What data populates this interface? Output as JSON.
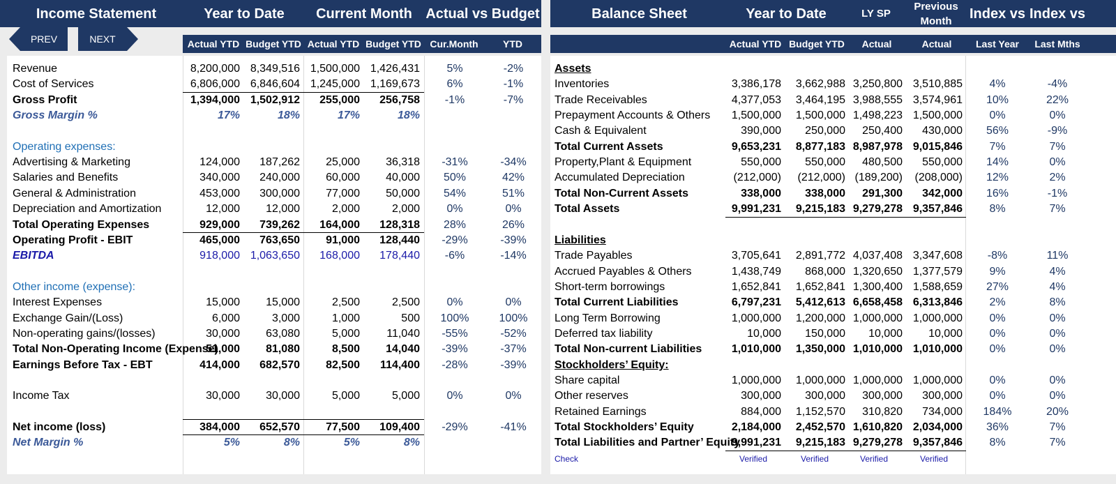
{
  "headers": {
    "left": [
      "Income Statement",
      "Year to Date",
      "Current Month",
      "Actual vs Budget"
    ],
    "right": [
      "Balance Sheet",
      "Year to Date",
      "LY SP",
      "Previous Month",
      "Index vs",
      "Index vs"
    ]
  },
  "nav": {
    "prev": "PREV",
    "next": "NEXT"
  },
  "subheaders": {
    "left": [
      "Actual YTD",
      "Budget YTD",
      "Actual YTD",
      "Budget YTD",
      "Cur.Month",
      "YTD"
    ],
    "right": [
      "Actual YTD",
      "Budget YTD",
      "Actual",
      "Actual",
      "Last Year",
      "Last Mths"
    ]
  },
  "income_rows": [
    {
      "label": "Revenue",
      "style": "n",
      "v": [
        "8,200,000",
        "8,349,516",
        "1,500,000",
        "1,426,431",
        "5%",
        "-2%"
      ]
    },
    {
      "label": "Cost of Services",
      "style": "n",
      "v": [
        "6,806,000",
        "6,846,604",
        "1,245,000",
        "1,169,673",
        "6%",
        "-1%"
      ]
    },
    {
      "label": "Gross Profit",
      "style": "b",
      "v": [
        "1,394,000",
        "1,502,912",
        "255,000",
        "256,758",
        "-1%",
        "-7%"
      ]
    },
    {
      "label": "Gross Margin %",
      "style": "m",
      "v": [
        "17%",
        "18%",
        "17%",
        "18%",
        "",
        ""
      ]
    },
    {
      "label": "",
      "style": "n",
      "v": [
        "",
        "",
        "",
        "",
        "",
        ""
      ]
    },
    {
      "label": "Operating expenses:",
      "style": "s",
      "v": [
        "",
        "",
        "",
        "",
        "",
        ""
      ]
    },
    {
      "label": "Advertising & Marketing",
      "style": "n",
      "v": [
        "124,000",
        "187,262",
        "25,000",
        "36,318",
        "-31%",
        "-34%"
      ]
    },
    {
      "label": "Salaries and Benefits",
      "style": "n",
      "v": [
        "340,000",
        "240,000",
        "60,000",
        "40,000",
        "50%",
        "42%"
      ]
    },
    {
      "label": "General & Administration",
      "style": "n",
      "v": [
        "453,000",
        "300,000",
        "77,000",
        "50,000",
        "54%",
        "51%"
      ]
    },
    {
      "label": "Depreciation and Amortization",
      "style": "n",
      "v": [
        "12,000",
        "12,000",
        "2,000",
        "2,000",
        "0%",
        "0%"
      ]
    },
    {
      "label": "Total Operating Expenses",
      "style": "b",
      "v": [
        "929,000",
        "739,262",
        "164,000",
        "128,318",
        "28%",
        "26%"
      ]
    },
    {
      "label": "Operating Profit - EBIT",
      "style": "b",
      "v": [
        "465,000",
        "763,650",
        "91,000",
        "128,440",
        "-29%",
        "-39%"
      ]
    },
    {
      "label": "EBITDA",
      "style": "e",
      "v": [
        "918,000",
        "1,063,650",
        "168,000",
        "178,440",
        "-6%",
        "-14%"
      ]
    },
    {
      "label": "",
      "style": "n",
      "v": [
        "",
        "",
        "",
        "",
        "",
        ""
      ]
    },
    {
      "label": "Other income (expense):",
      "style": "s",
      "v": [
        "",
        "",
        "",
        "",
        "",
        ""
      ]
    },
    {
      "label": "Interest Expenses",
      "style": "n",
      "v": [
        "15,000",
        "15,000",
        "2,500",
        "2,500",
        "0%",
        "0%"
      ]
    },
    {
      "label": "Exchange Gain/(Loss)",
      "style": "n",
      "v": [
        "6,000",
        "3,000",
        "1,000",
        "500",
        "100%",
        "100%"
      ]
    },
    {
      "label": "Non-operating gains/(losses)",
      "style": "n",
      "v": [
        "30,000",
        "63,080",
        "5,000",
        "11,040",
        "-55%",
        "-52%"
      ]
    },
    {
      "label": "Total Non-Operating Income (Expense)",
      "style": "b",
      "v": [
        "51,000",
        "81,080",
        "8,500",
        "14,040",
        "-39%",
        "-37%"
      ]
    },
    {
      "label": "Earnings Before Tax - EBT",
      "style": "b",
      "v": [
        "414,000",
        "682,570",
        "82,500",
        "114,400",
        "-28%",
        "-39%"
      ]
    },
    {
      "label": "",
      "style": "n",
      "v": [
        "",
        "",
        "",
        "",
        "",
        ""
      ]
    },
    {
      "label": "Income Tax",
      "style": "n",
      "v": [
        "30,000",
        "30,000",
        "5,000",
        "5,000",
        "0%",
        "0%"
      ]
    },
    {
      "label": "",
      "style": "n",
      "v": [
        "",
        "",
        "",
        "",
        "",
        ""
      ]
    },
    {
      "label": "Net income (loss)",
      "style": "b",
      "v": [
        "384,000",
        "652,570",
        "77,500",
        "109,400",
        "-29%",
        "-41%"
      ]
    },
    {
      "label": "Net Margin %",
      "style": "m",
      "v": [
        "5%",
        "8%",
        "5%",
        "8%",
        "",
        ""
      ]
    }
  ],
  "balance_rows": [
    {
      "label": "Assets",
      "style": "u",
      "v": [
        "",
        "",
        "",
        "",
        "",
        ""
      ]
    },
    {
      "label": "Inventories",
      "style": "n",
      "v": [
        "3,386,178",
        "3,662,988",
        "3,250,800",
        "3,510,885",
        "4%",
        "-4%"
      ]
    },
    {
      "label": "Trade Receivables",
      "style": "n",
      "v": [
        "4,377,053",
        "3,464,195",
        "3,988,555",
        "3,574,961",
        "10%",
        "22%"
      ]
    },
    {
      "label": "Prepayment Accounts & Others",
      "style": "n",
      "v": [
        "1,500,000",
        "1,500,000",
        "1,498,223",
        "1,500,000",
        "0%",
        "0%"
      ]
    },
    {
      "label": "Cash  & Equivalent",
      "style": "n",
      "v": [
        "390,000",
        "250,000",
        "250,400",
        "430,000",
        "56%",
        "-9%"
      ]
    },
    {
      "label": "Total Current Assets",
      "style": "b",
      "v": [
        "9,653,231",
        "8,877,183",
        "8,987,978",
        "9,015,846",
        "7%",
        "7%"
      ]
    },
    {
      "label": "Property,Plant & Equipment",
      "style": "n",
      "v": [
        "550,000",
        "550,000",
        "480,500",
        "550,000",
        "14%",
        "0%"
      ]
    },
    {
      "label": "Accumulated Depreciation",
      "style": "n",
      "v": [
        "(212,000)",
        "(212,000)",
        "(189,200)",
        "(208,000)",
        "12%",
        "2%"
      ]
    },
    {
      "label": "Total Non-Current Assets",
      "style": "b",
      "v": [
        "338,000",
        "338,000",
        "291,300",
        "342,000",
        "16%",
        "-1%"
      ]
    },
    {
      "label": "Total Assets",
      "style": "b",
      "v": [
        "9,991,231",
        "9,215,183",
        "9,279,278",
        "9,357,846",
        "8%",
        "7%"
      ]
    },
    {
      "label": "",
      "style": "n",
      "v": [
        "",
        "",
        "",
        "",
        "",
        ""
      ]
    },
    {
      "label": "Liabilities",
      "style": "u",
      "v": [
        "",
        "",
        "",
        "",
        "",
        ""
      ]
    },
    {
      "label": "Trade Payables",
      "style": "n",
      "v": [
        "3,705,641",
        "2,891,772",
        "4,037,408",
        "3,347,608",
        "-8%",
        "11%"
      ]
    },
    {
      "label": "Accrued Payables & Others",
      "style": "n",
      "v": [
        "1,438,749",
        "868,000",
        "1,320,650",
        "1,377,579",
        "9%",
        "4%"
      ]
    },
    {
      "label": "Short-term borrowings",
      "style": "n",
      "v": [
        "1,652,841",
        "1,652,841",
        "1,300,400",
        "1,588,659",
        "27%",
        "4%"
      ]
    },
    {
      "label": "Total Current Liabilities",
      "style": "b",
      "v": [
        "6,797,231",
        "5,412,613",
        "6,658,458",
        "6,313,846",
        "2%",
        "8%"
      ]
    },
    {
      "label": "Long Term Borrowing",
      "style": "n",
      "v": [
        "1,000,000",
        "1,200,000",
        "1,000,000",
        "1,000,000",
        "0%",
        "0%"
      ]
    },
    {
      "label": "Deferred tax liability",
      "style": "n",
      "v": [
        "10,000",
        "150,000",
        "10,000",
        "10,000",
        "0%",
        "0%"
      ]
    },
    {
      "label": "Total Non-current Liabilities",
      "style": "b",
      "v": [
        "1,010,000",
        "1,350,000",
        "1,010,000",
        "1,010,000",
        "0%",
        "0%"
      ]
    },
    {
      "label": "Stockholders’ Equity:",
      "style": "u",
      "v": [
        "",
        "",
        "",
        "",
        "",
        ""
      ]
    },
    {
      "label": "Share capital",
      "style": "n",
      "v": [
        "1,000,000",
        "1,000,000",
        "1,000,000",
        "1,000,000",
        "0%",
        "0%"
      ]
    },
    {
      "label": "Other reserves",
      "style": "n",
      "v": [
        "300,000",
        "300,000",
        "300,000",
        "300,000",
        "0%",
        "0%"
      ]
    },
    {
      "label": "Retained Earnings",
      "style": "n",
      "v": [
        "884,000",
        "1,152,570",
        "310,820",
        "734,000",
        "184%",
        "20%"
      ]
    },
    {
      "label": "Total Stockholders’ Equity",
      "style": "b",
      "v": [
        "2,184,000",
        "2,452,570",
        "1,610,820",
        "2,034,000",
        "36%",
        "7%"
      ]
    },
    {
      "label": "Total Liabilities and Partner’ Equity",
      "style": "b",
      "v": [
        "9,991,231",
        "9,215,183",
        "9,279,278",
        "9,357,846",
        "8%",
        "7%"
      ]
    },
    {
      "label": "Check",
      "style": "k",
      "v": [
        "Verified",
        "Verified",
        "Verified",
        "Verified",
        "",
        ""
      ]
    }
  ]
}
